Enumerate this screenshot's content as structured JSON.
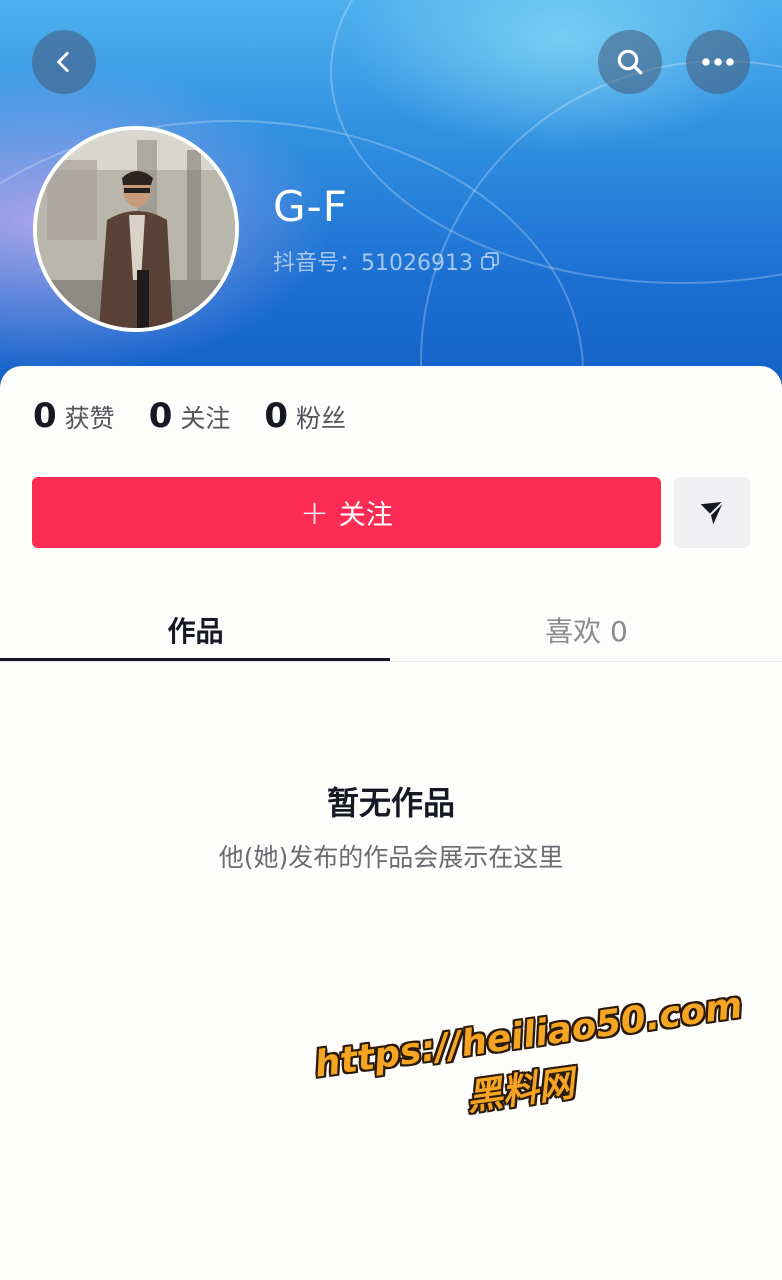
{
  "header": {
    "back_icon": "chevron-left-icon",
    "search_icon": "search-icon",
    "more_icon": "more-horizontal-icon"
  },
  "profile": {
    "name": "G-F",
    "douyin_id": "抖音号：51026913",
    "copy_icon": "copy-icon"
  },
  "stats": [
    {
      "value": "0",
      "label": "获赞"
    },
    {
      "value": "0",
      "label": "关注"
    },
    {
      "value": "0",
      "label": "粉丝"
    }
  ],
  "actions": {
    "follow_plus": "+",
    "follow_label": "关注",
    "message_icon": "send-icon"
  },
  "tabs": {
    "works": "作品",
    "likes": "喜欢 0"
  },
  "empty_state": {
    "title": "暂无作品",
    "subtitle": "他(她)发布的作品会展示在这里"
  },
  "watermark": {
    "url": "https://heiliao50.com",
    "site_name": "黑料网"
  },
  "colors": {
    "accent": "#fe2c55",
    "header_blue": "#2f8fe0"
  }
}
